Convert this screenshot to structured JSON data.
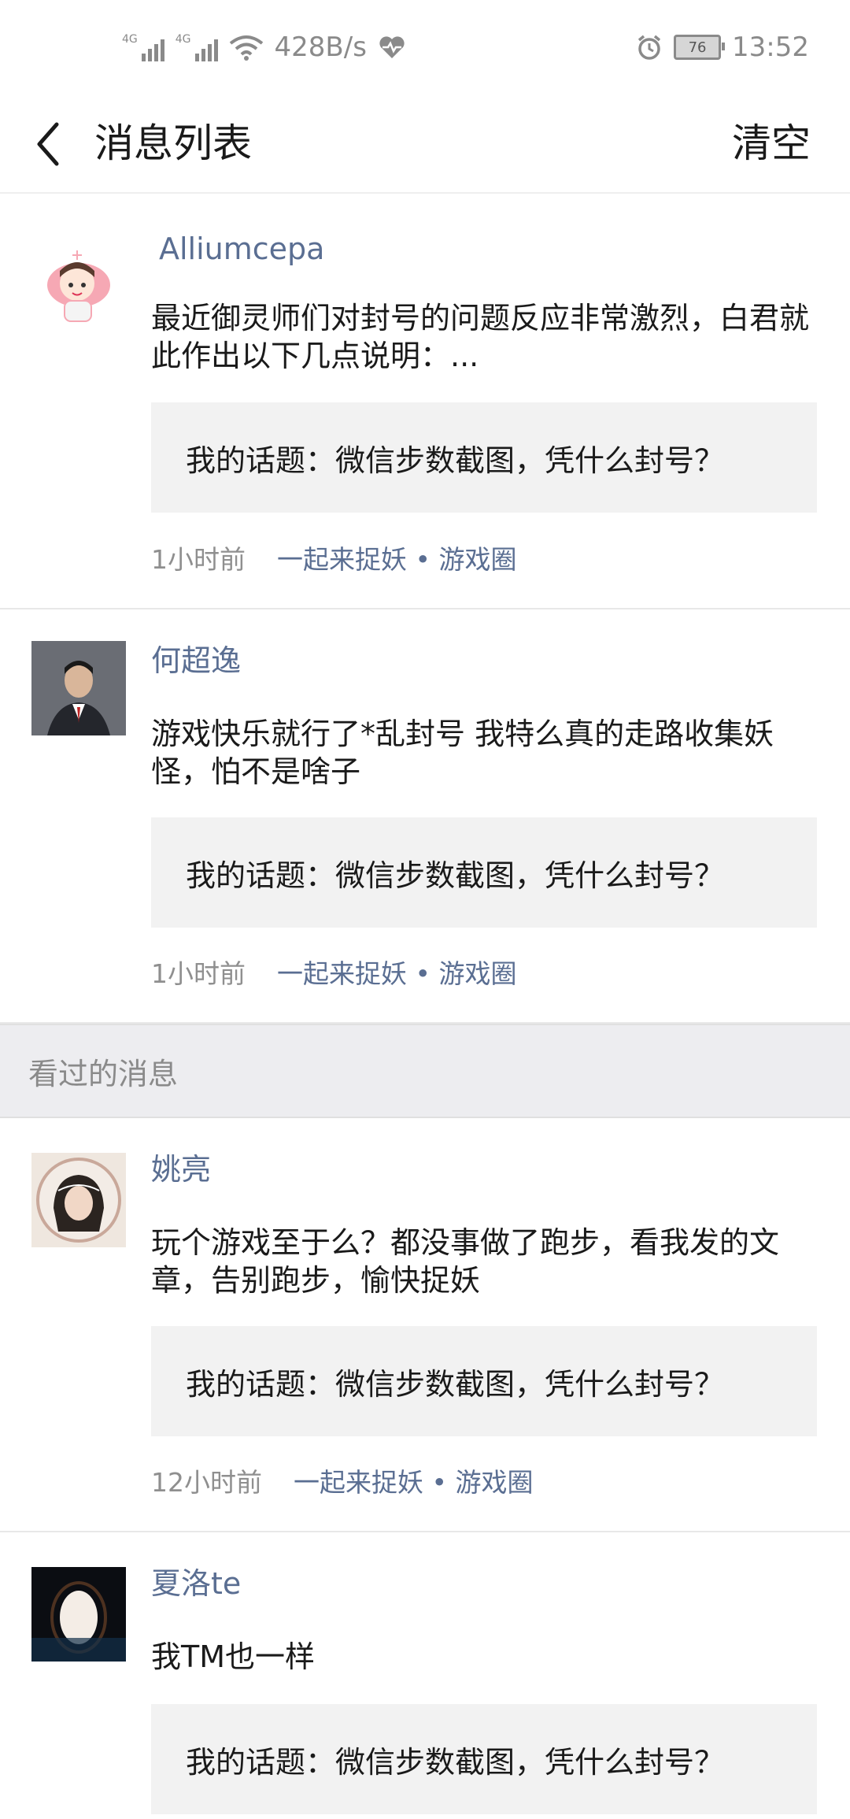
{
  "status": {
    "net_speed": "428B/s",
    "battery": "76",
    "time": "13:52",
    "signal_label": "4G"
  },
  "header": {
    "title": "消息列表",
    "clear_label": "清空"
  },
  "section_label": "看过的消息",
  "messages": [
    {
      "user": "Alliumcepa",
      "text": "最近御灵师们对封号的问题反应非常激烈，白君就此作出以下几点说明：...",
      "quote": "我的话题：微信步数截图，凭什么封号？",
      "time": "1小时前",
      "source": "一起来捉妖 • 游戏圈"
    },
    {
      "user": "何超逸",
      "text": "游戏快乐就行了*乱封号 我特么真的走路收集妖怪，怕不是啥子",
      "quote": "我的话题：微信步数截图，凭什么封号？",
      "time": "1小时前",
      "source": "一起来捉妖 • 游戏圈"
    },
    {
      "user": "姚亮",
      "text": "玩个游戏至于么？都没事做了跑步，看我发的文章，告别跑步，愉快捉妖",
      "quote": "我的话题：微信步数截图，凭什么封号？",
      "time": "12小时前",
      "source": "一起来捉妖 • 游戏圈"
    },
    {
      "user": "夏洛te",
      "text": "我TM也一样",
      "quote": "我的话题：微信步数截图，凭什么封号？"
    }
  ]
}
